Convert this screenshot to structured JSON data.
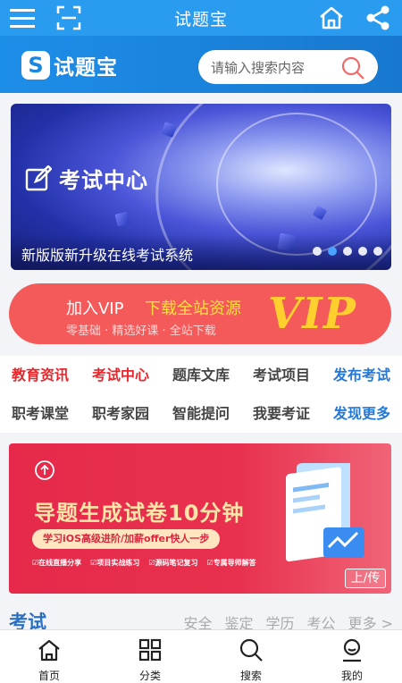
{
  "topbar": {
    "title": "试题宝",
    "menu_icon": "hamburger-menu-icon",
    "scan_icon": "scan-icon",
    "home_icon": "home-icon",
    "share_icon": "share-icon"
  },
  "header": {
    "logo_mark": "S",
    "logo_text": "试题宝",
    "search_placeholder": "请输入搜索内容",
    "search_icon": "search-icon"
  },
  "banner": {
    "heading": "考试中心",
    "caption": "新版版新升级在线考试系统",
    "dots": [
      false,
      true,
      false,
      false,
      false
    ]
  },
  "vip": {
    "join": "加入VIP",
    "download": "下载全站资源",
    "sub": "零基础 · 精选好课 · 全站下载",
    "vip_word": "VIP"
  },
  "categories": {
    "row1": [
      "教育资讯",
      "考试中心",
      "题库文库",
      "考试项目",
      "发布考试"
    ],
    "row2": [
      "职考课堂",
      "职考家园",
      "智能提问",
      "我要考证",
      "发现更多"
    ]
  },
  "promo": {
    "headline": "导题生成试卷10分钟",
    "tag": "学习iOS高级进阶/加薪offer快人一步",
    "features": [
      "☑在线直播分享",
      "☑项目实战练习",
      "☑源码笔记复习",
      "☑专属导师解答"
    ],
    "badge": "上/传"
  },
  "section": {
    "title": "考试",
    "links": [
      "安全",
      "鉴定",
      "学历",
      "考公",
      "更多 >"
    ]
  },
  "bottom_nav": [
    {
      "label": "首页",
      "icon": "home-icon"
    },
    {
      "label": "分类",
      "icon": "grid-icon"
    },
    {
      "label": "搜索",
      "icon": "search-icon"
    },
    {
      "label": "我的",
      "icon": "user-icon"
    }
  ],
  "colors": {
    "primary": "#2a9cf0",
    "vip_bg": "#f45a5a",
    "category_red": "#e8262b",
    "category_blue": "#2678d6",
    "promo_bg": "#e6294a",
    "section_title": "#2a6fc4"
  }
}
